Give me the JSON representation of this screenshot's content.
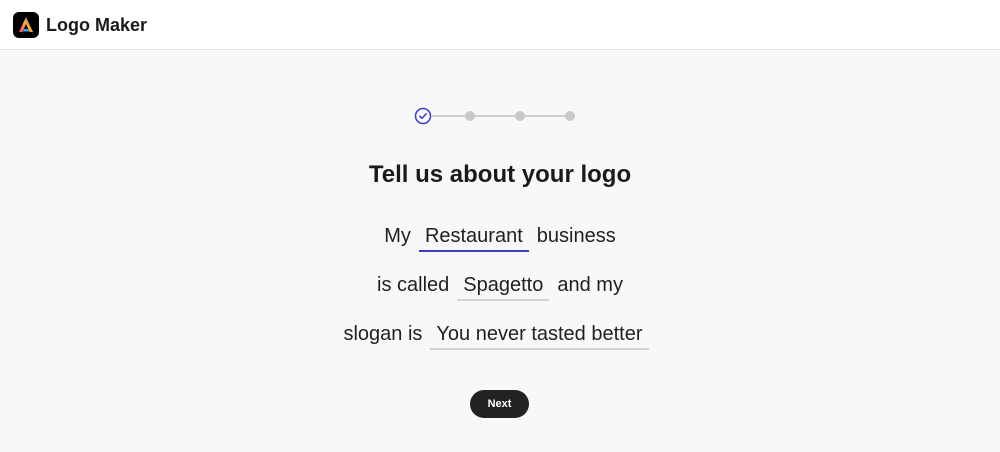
{
  "app": {
    "title": "Logo Maker",
    "logo_icon": "adobe-express-icon"
  },
  "stepper": {
    "total_steps": 4,
    "current_step": 1,
    "completed_icon": "check-circle-icon",
    "active_color": "#3d3dbf"
  },
  "heading": "Tell us about your logo",
  "form": {
    "line1": {
      "prefix": "My",
      "field_value": "Restaurant",
      "suffix": "business"
    },
    "line2": {
      "prefix": "is called",
      "field_value": "Spagetto",
      "suffix": "and my"
    },
    "line3": {
      "prefix": "slogan is",
      "field_value": "You never tasted better"
    }
  },
  "buttons": {
    "next_label": "Next"
  }
}
